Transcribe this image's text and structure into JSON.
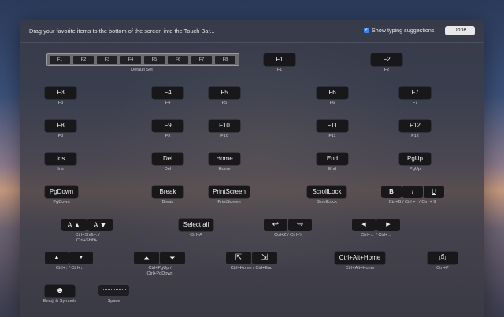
{
  "header": {
    "instruction": "Drag your favorite items to the bottom of the screen into the Touch Bar...",
    "suggestions_label": "Show typing suggestions",
    "suggestions_checked": true,
    "done_label": "Done"
  },
  "default_set": {
    "keys": [
      "F1",
      "F2",
      "F3",
      "F4",
      "F5",
      "F6",
      "F7",
      "F8"
    ],
    "label": "Default Set"
  },
  "keys": {
    "f1": {
      "key": "F1",
      "label": "F1"
    },
    "f2": {
      "key": "F2",
      "label": "F2"
    },
    "f3": {
      "key": "F3",
      "label": "F3"
    },
    "f4": {
      "key": "F4",
      "label": "F4"
    },
    "f5": {
      "key": "F5",
      "label": "F5"
    },
    "f6": {
      "key": "F6",
      "label": "F6"
    },
    "f7": {
      "key": "F7",
      "label": "F7"
    },
    "f8": {
      "key": "F8",
      "label": "F8"
    },
    "f9": {
      "key": "F9",
      "label": "F9"
    },
    "f10": {
      "key": "F10",
      "label": "F10"
    },
    "f11": {
      "key": "F11",
      "label": "F11"
    },
    "f12": {
      "key": "F12",
      "label": "F12"
    },
    "ins": {
      "key": "Ins",
      "label": "Ins"
    },
    "del": {
      "key": "Del",
      "label": "Del"
    },
    "home": {
      "key": "Home",
      "label": "Home"
    },
    "end": {
      "key": "End",
      "label": "End"
    },
    "pgup": {
      "key": "PgUp",
      "label": "PgUp"
    },
    "pgdown": {
      "key": "PgDown",
      "label": "PgDown"
    },
    "break": {
      "key": "Break",
      "label": "Break"
    },
    "printscreen": {
      "key": "PrintScreen",
      "label": "PrintScreen"
    },
    "scrolllock": {
      "key": "ScrollLock",
      "label": "ScrollLock"
    },
    "selectall": {
      "key": "Select all",
      "label": "Ctrl+A"
    },
    "ctrlalthome": {
      "key": "Ctrl+Alt+Home",
      "label": "Ctrl+Alt+Home"
    }
  },
  "groups": {
    "biu": {
      "bold": "B",
      "italic": "I",
      "underline": "U",
      "label": "Ctrl+B / Ctrl + I / Ctrl + U"
    },
    "fontsize": {
      "a_up": "A ▲",
      "a_down": "A ▼",
      "label_line1": "Ctrl+Shift+. /",
      "label_line2": "Ctrl+Shift+,"
    },
    "undo": {
      "undo_icon": "↩",
      "redo_icon": "↪",
      "label": "Ctrl+Z / Ctrl+Y"
    },
    "leftright": {
      "left_icon": "◀",
      "right_icon": "▶",
      "label": "Ctrl+← / Ctrl+→"
    },
    "updown": {
      "up_icon": "▲",
      "down_icon": "▼",
      "label": "Ctrl+↑ / Ctrl+↓"
    },
    "pgupdown": {
      "up_icon": "⏶",
      "down_icon": "⏷",
      "label_line1": "Ctrl+PgUp /",
      "label_line2": "Ctrl+PgDown"
    },
    "homeend": {
      "home_icon": "⇱",
      "end_icon": "⇲",
      "label": "Ctrl+Home / Ctrl+End"
    },
    "print": {
      "icon": "⎙",
      "label": "Ctrl+P"
    },
    "emoji": {
      "icon": "☻",
      "label": "Emoji & Symbols"
    },
    "space": {
      "label": "Space"
    }
  }
}
